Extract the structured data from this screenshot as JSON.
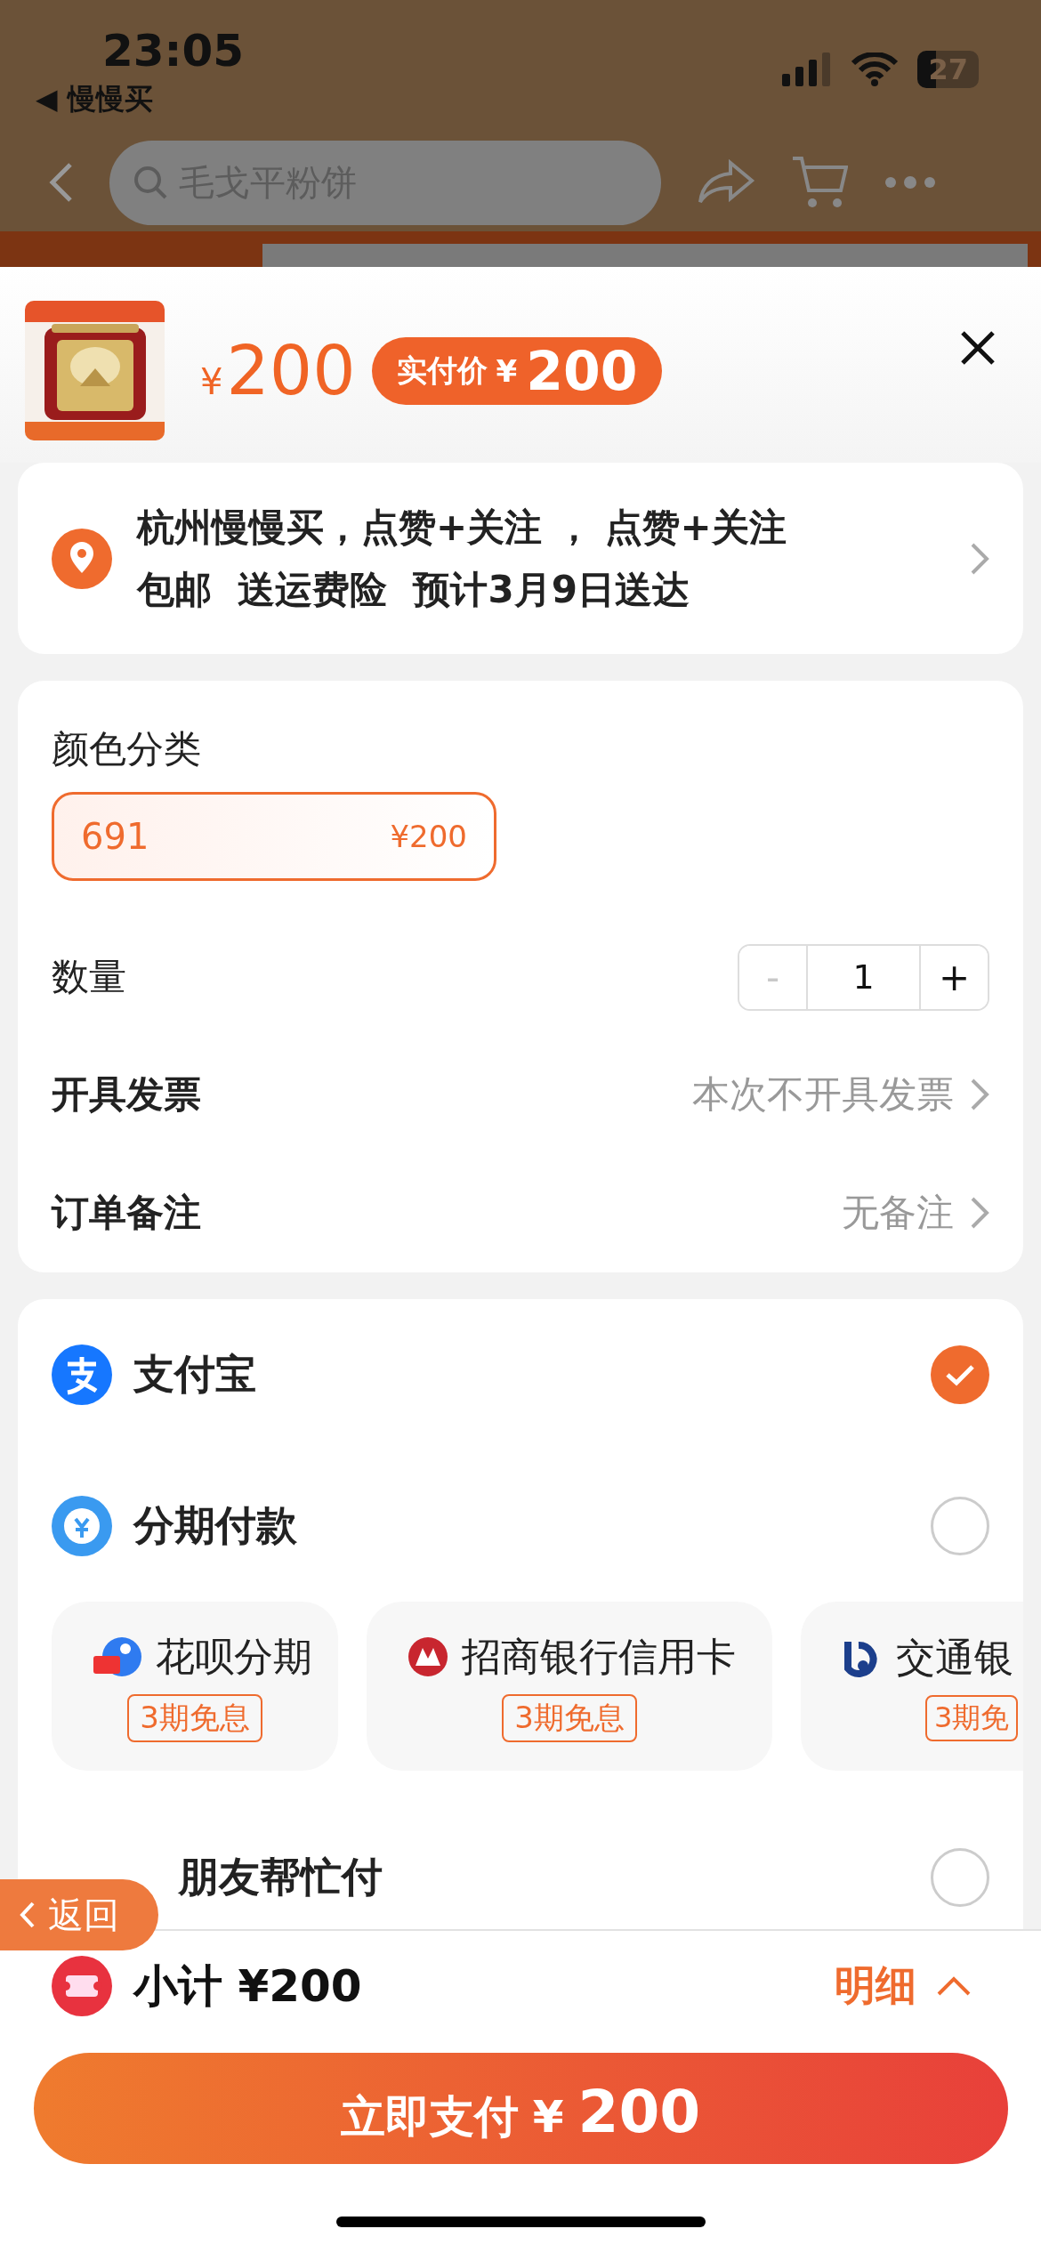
{
  "status_bar": {
    "time": "23:05",
    "back_app": "◀ 慢慢买",
    "battery": "27"
  },
  "nav": {
    "search_placeholder": "毛戈平粉饼"
  },
  "product": {
    "price_symbol": "¥",
    "price": "200",
    "badge_label": "实付价",
    "badge_symbol": "¥",
    "badge_price": "200"
  },
  "address": {
    "line1": "杭州慢慢买，点赞+关注 ， 点赞+关注",
    "line2": "包邮  送运费险  预计3月9日送达"
  },
  "options": {
    "color_label": "颜色分类",
    "variants": [
      {
        "name": "691",
        "price": "¥200",
        "selected": true
      }
    ],
    "quantity": {
      "label": "数量",
      "minus": "-",
      "value": "1",
      "plus": "+",
      "minus_disabled": true
    },
    "invoice": {
      "label": "开具发票",
      "value": "本次不开具发票"
    },
    "note": {
      "label": "订单备注",
      "value": "无备注"
    }
  },
  "payment_methods": [
    {
      "kind": "alipay",
      "label": "支付宝",
      "selected": true
    },
    {
      "kind": "installment",
      "label": "分期付款",
      "selected": false
    },
    {
      "kind": "friend",
      "label": "朋友帮忙付",
      "selected": false
    }
  ],
  "installment_plans": [
    {
      "kind": "huabei",
      "name": "花呗分期",
      "tag": "3期免息"
    },
    {
      "kind": "cmb",
      "name": "招商银行信用卡",
      "tag": "3期免息"
    },
    {
      "kind": "bocom",
      "name": "交通银",
      "tag": "3期免"
    }
  ],
  "back_button": "返回",
  "bottom": {
    "subtotal_label": "小计",
    "subtotal": "¥200",
    "details": "明细",
    "pay_label": "立即支付",
    "pay_symbol": "¥",
    "pay_amount": "200"
  }
}
